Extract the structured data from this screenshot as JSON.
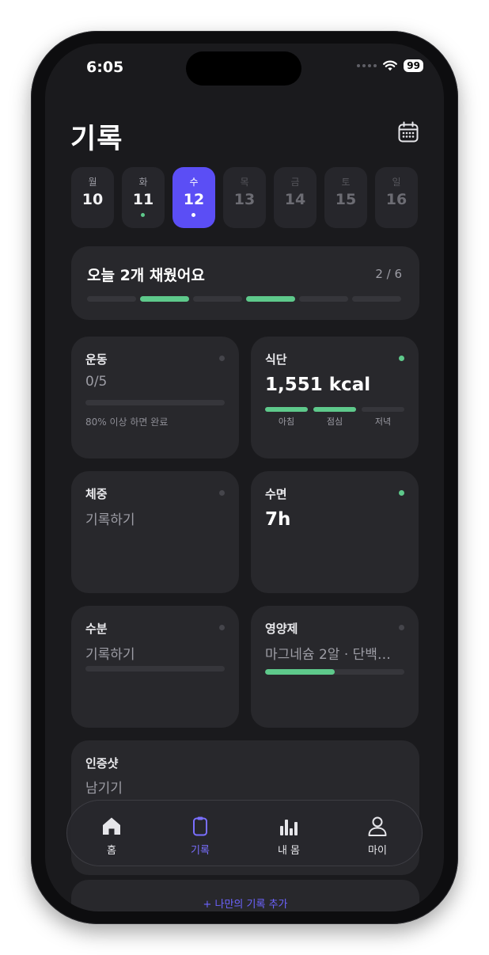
{
  "status_bar": {
    "time": "6:05",
    "battery": "99"
  },
  "header": {
    "title": "기록",
    "calendar_icon": "calendar-icon"
  },
  "week": [
    {
      "name": "월",
      "num": "10",
      "state": "past",
      "dot": false
    },
    {
      "name": "화",
      "num": "11",
      "state": "past",
      "dot": true
    },
    {
      "name": "수",
      "num": "12",
      "state": "selected",
      "dot": true
    },
    {
      "name": "목",
      "num": "13",
      "state": "future",
      "dot": false
    },
    {
      "name": "금",
      "num": "14",
      "state": "future",
      "dot": false
    },
    {
      "name": "토",
      "num": "15",
      "state": "future",
      "dot": false
    },
    {
      "name": "일",
      "num": "16",
      "state": "future",
      "dot": false
    }
  ],
  "summary": {
    "text": "오늘 2개 채웠어요",
    "count": "2 / 6",
    "segments_done": [
      false,
      true,
      false,
      true,
      false,
      false
    ]
  },
  "cards": {
    "exercise": {
      "title": "운동",
      "value": "0/5",
      "note": "80% 이상 하면 완료",
      "progress": 0,
      "done": false
    },
    "diet": {
      "title": "식단",
      "value": "1,551 kcal",
      "done": true,
      "meals": [
        {
          "label": "아침",
          "done": true
        },
        {
          "label": "점심",
          "done": true
        },
        {
          "label": "저녁",
          "done": false
        }
      ]
    },
    "weight": {
      "title": "체중",
      "value": "기록하기",
      "done": false
    },
    "sleep": {
      "title": "수면",
      "value": "7h",
      "done": true
    },
    "water": {
      "title": "수분",
      "value": "기록하기",
      "progress": 0,
      "done": false
    },
    "supplements": {
      "title": "영양제",
      "value": "마그네슘 2알 · 단백…",
      "progress": 0.5,
      "done": false
    },
    "photo": {
      "title": "인증샷",
      "value": "남기기"
    }
  },
  "add_custom": "+ 나만의 기록 추가",
  "tabbar": {
    "items": [
      {
        "label": "홈",
        "icon": "home-icon",
        "active": false
      },
      {
        "label": "기록",
        "icon": "clipboard-icon",
        "active": true
      },
      {
        "label": "내 몸",
        "icon": "bar-chart-icon",
        "active": false
      },
      {
        "label": "마이",
        "icon": "person-icon",
        "active": false
      }
    ]
  },
  "colors": {
    "accent": "#5b4ef5",
    "success": "#5ec98b",
    "background": "#1a1a1d",
    "card": "#28282c"
  }
}
